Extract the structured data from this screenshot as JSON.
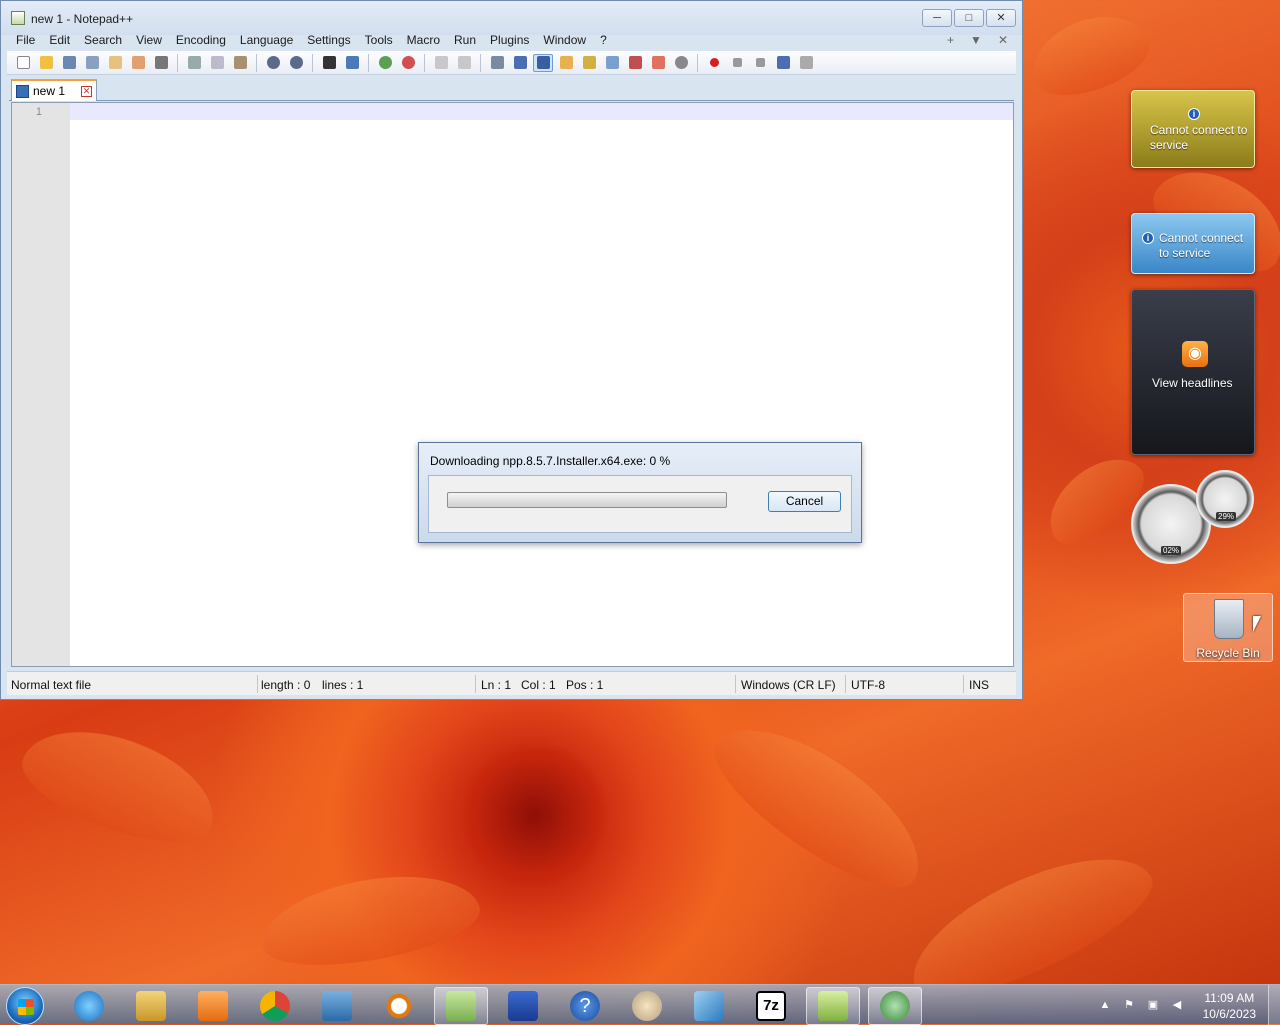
{
  "window": {
    "title": "new 1 - Notepad++",
    "controls": {
      "minimize": "─",
      "maximize": "□",
      "close": "✕"
    }
  },
  "menu": {
    "items": [
      "File",
      "Edit",
      "Search",
      "View",
      "Encoding",
      "Language",
      "Settings",
      "Tools",
      "Macro",
      "Run",
      "Plugins",
      "Window",
      "?"
    ],
    "right": [
      "+",
      "▼",
      "✕"
    ]
  },
  "tabs": [
    {
      "label": "new 1",
      "close": "✕"
    }
  ],
  "editor": {
    "line_number": "1"
  },
  "statusbar": {
    "type": "Normal text file",
    "length": "length : 0",
    "lines": "lines : 1",
    "ln": "Ln : 1",
    "col": "Col : 1",
    "pos": "Pos : 1",
    "eol": "Windows (CR LF)",
    "encoding": "UTF-8",
    "mode": "INS"
  },
  "download_dialog": {
    "title": "Downloading npp.8.5.7.Installer.x64.exe: 0 %",
    "progress": 0,
    "cancel_label": "Cancel"
  },
  "gadgets": {
    "weather1": "Cannot connect to service",
    "weather2": "Cannot connect to service",
    "feed": "View headlines",
    "cpu_meter": "02%",
    "mem_meter": "29%"
  },
  "desktop": {
    "recycle_bin": "Recycle Bin"
  },
  "taskbar": {
    "icons": [
      "internet-explorer",
      "file-explorer",
      "media-player",
      "chrome",
      "control-panel",
      "search",
      "explorer-folder",
      "network",
      "help",
      "paint",
      "mail",
      "7zip",
      "notepad-plus-plus",
      "wupdate"
    ],
    "clock_time": "11:09 AM",
    "clock_date": "10/6/2023"
  },
  "colors": {
    "progress_fill": "#36b83a",
    "accent_tab": "#f2a13b"
  }
}
